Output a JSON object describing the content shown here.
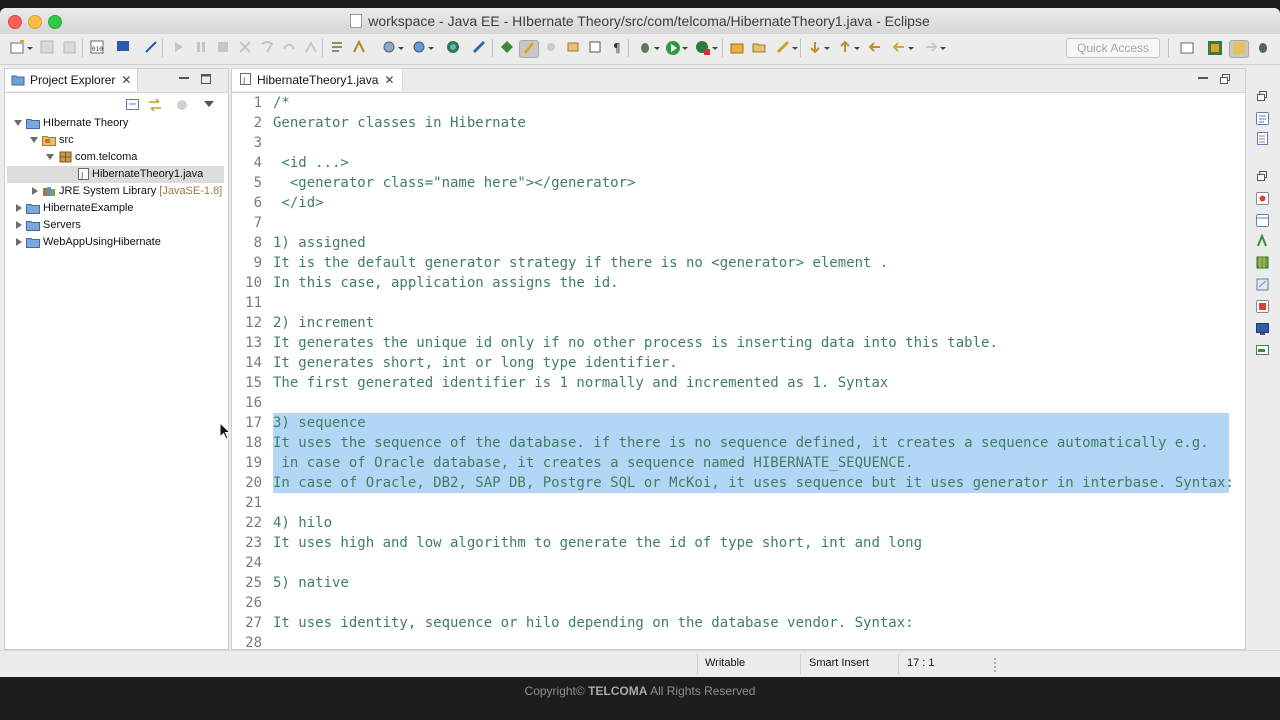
{
  "window": {
    "title": "workspace - Java EE - HIbernate Theory/src/com/telcoma/HibernateTheory1.java - Eclipse"
  },
  "toolbar": {
    "quick_access_placeholder": "Quick Access"
  },
  "explorer": {
    "tab_label": "Project Explorer",
    "tree": [
      {
        "label": "HIbernate Theory",
        "level": 0,
        "expanded": true,
        "icon": "project-icon"
      },
      {
        "label": "src",
        "level": 1,
        "expanded": true,
        "icon": "source-folder-icon"
      },
      {
        "label": "com.telcoma",
        "level": 2,
        "expanded": true,
        "icon": "package-icon"
      },
      {
        "label": "HibernateTheory1.java",
        "level": 3,
        "selected": true,
        "icon": "java-file-icon"
      },
      {
        "label": "JRE System Library",
        "suffix": "[JavaSE-1.8]",
        "level": 1,
        "expanded": false,
        "icon": "library-icon"
      },
      {
        "label": "HibernateExample",
        "level": 0,
        "expanded": false,
        "icon": "project-icon"
      },
      {
        "label": "Servers",
        "level": 0,
        "expanded": false,
        "icon": "folder-icon"
      },
      {
        "label": "WebAppUsingHibernate",
        "level": 0,
        "expanded": false,
        "icon": "project-icon"
      }
    ]
  },
  "editor": {
    "tab_label": "HibernateTheory1.java",
    "lines": [
      {
        "n": "1",
        "text": "/*"
      },
      {
        "n": "2",
        "text": "Generator classes in Hibernate"
      },
      {
        "n": "3",
        "text": ""
      },
      {
        "n": "4",
        "text": " <id ...>"
      },
      {
        "n": "5",
        "text": "  <generator class=\"name here\"></generator>"
      },
      {
        "n": "6",
        "text": " </id>"
      },
      {
        "n": "7",
        "text": ""
      },
      {
        "n": "8",
        "text": "1) assigned"
      },
      {
        "n": "9",
        "text": "It is the default generator strategy if there is no <generator> element ."
      },
      {
        "n": "10",
        "text": "In this case, application assigns the id."
      },
      {
        "n": "11",
        "text": ""
      },
      {
        "n": "12",
        "text": "2) increment"
      },
      {
        "n": "13",
        "text": "It generates the unique id only if no other process is inserting data into this table."
      },
      {
        "n": "14",
        "text": "It generates short, int or long type identifier."
      },
      {
        "n": "15",
        "text": "The first generated identifier is 1 normally and incremented as 1. Syntax"
      },
      {
        "n": "16",
        "text": ""
      },
      {
        "n": "17",
        "text": "3) sequence",
        "highlighted": true
      },
      {
        "n": "18",
        "text": "It uses the sequence of the database. if there is no sequence defined, it creates a sequence automatically e.g.",
        "highlighted": true
      },
      {
        "n": "19",
        "text": " in case of Oracle database, it creates a sequence named HIBERNATE_SEQUENCE.",
        "highlighted": true
      },
      {
        "n": "20",
        "text": "In case of Oracle, DB2, SAP DB, Postgre SQL or McKoi, it uses sequence but it uses generator in interbase. Syntax:",
        "highlighted": true
      },
      {
        "n": "21",
        "text": ""
      },
      {
        "n": "22",
        "text": "4) hilo"
      },
      {
        "n": "23",
        "text": "It uses high and low algorithm to generate the id of type short, int and long"
      },
      {
        "n": "24",
        "text": ""
      },
      {
        "n": "25",
        "text": "5) native"
      },
      {
        "n": "26",
        "text": ""
      },
      {
        "n": "27",
        "text": "It uses identity, sequence or hilo depending on the database vendor. Syntax:"
      },
      {
        "n": "28",
        "text": ""
      }
    ]
  },
  "status": {
    "writable": "Writable",
    "insert_mode": "Smart Insert",
    "position": "17 : 1"
  },
  "footer": {
    "prefix": "Copyright©",
    "brand": "TELCOMA",
    "suffix": "All Rights Reserved"
  },
  "colors": {
    "comment_text": "#3f7f5f",
    "selection": "#b4d6f6",
    "close_light": "#fc605c",
    "minimize_light": "#fdbc40",
    "maximize_light": "#34c84a"
  }
}
